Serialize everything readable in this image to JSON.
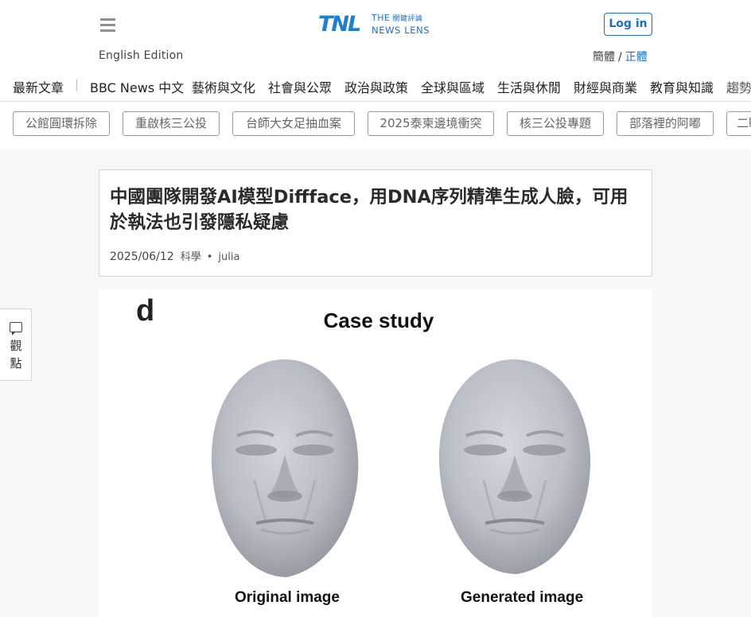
{
  "header": {
    "logo": {
      "mark": "TNL",
      "line1": "THE",
      "line1_zh": "關鍵評論",
      "line2": "NEWS LENS"
    },
    "login_label": "Log in",
    "edition_label": "English Edition",
    "lang": {
      "simplified": "簡體",
      "separator": "/",
      "traditional": "正體"
    }
  },
  "categories": [
    "最新文章",
    "BBC News 中文",
    "藝術與文化",
    "社會與公眾",
    "政治與政策",
    "全球與區域",
    "生活與休閒",
    "財經與商業",
    "教育與知識",
    "趨勢"
  ],
  "tags": [
    "公館圓環拆除",
    "重啟核三公投",
    "台師大女足抽血案",
    "2025泰柬邊境衝突",
    "核三公投專題",
    "部落裡的阿嘟",
    "二戰"
  ],
  "side_tab": {
    "label_1": "觀",
    "label_2": "點"
  },
  "article": {
    "title": "中國團隊開發AI模型Diffface，用DNA序列精準生成人臉，可用於執法也引發隱私疑慮",
    "date": "2025/06/12",
    "category": "科學",
    "dot": "•",
    "author": "julia"
  },
  "figure": {
    "panel_letter": "d",
    "title": "Case study",
    "caption_left": "Original image",
    "caption_right": "Generated image"
  },
  "colors": {
    "brand_blue": "#1e6fbf",
    "logo_blue": "#1e7fd0"
  }
}
